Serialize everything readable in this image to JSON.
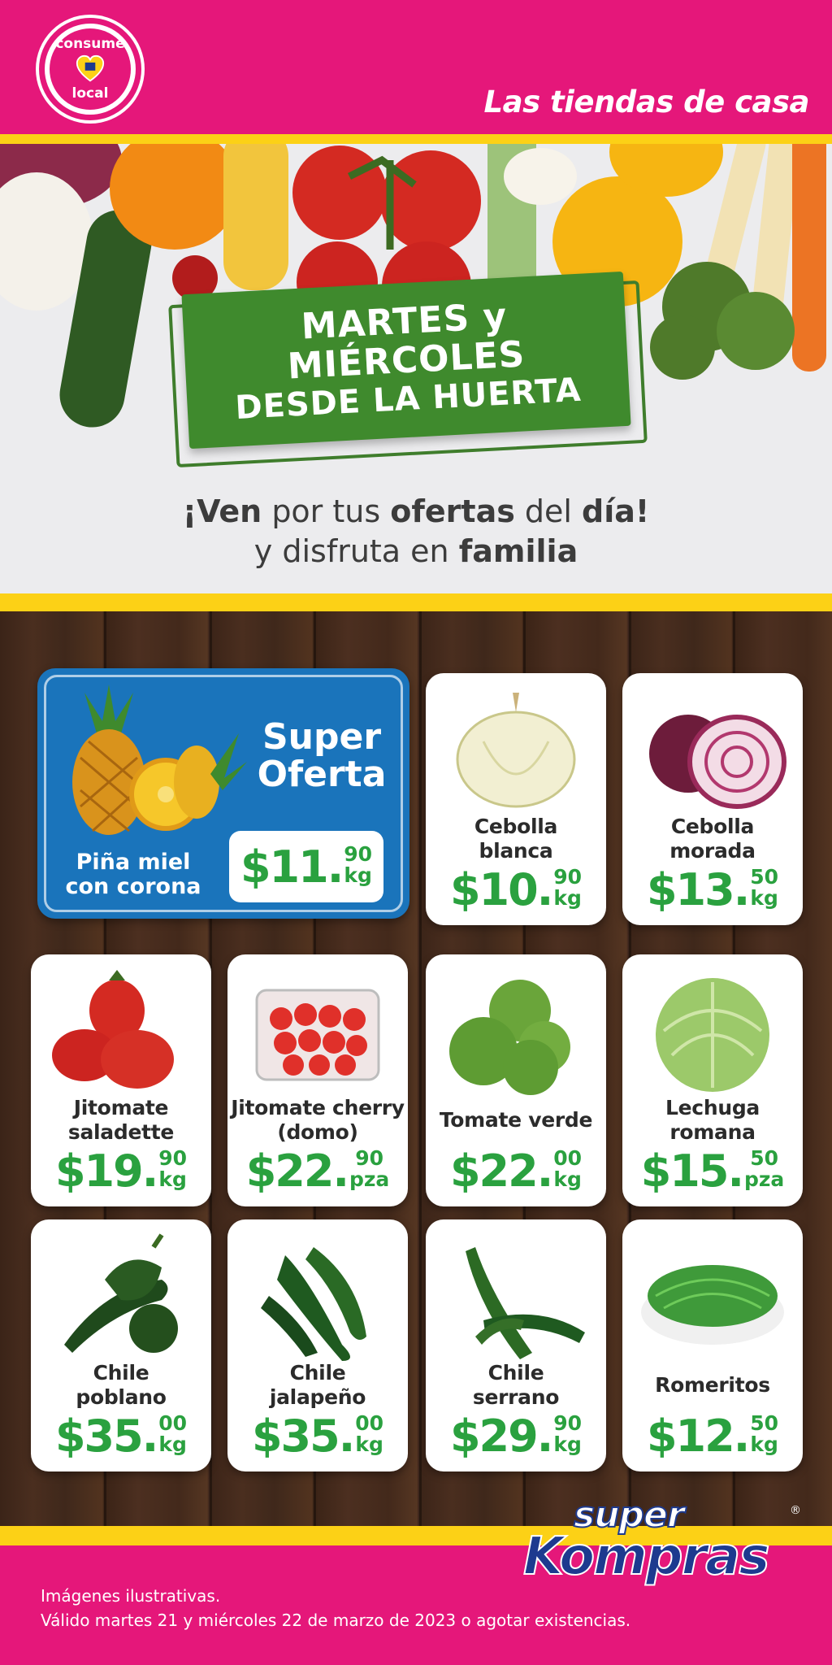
{
  "header": {
    "badge": {
      "top_word": "consume",
      "bottom_word": "local"
    },
    "tagline": "Las tiendas de casa"
  },
  "hero": {
    "sign_line1": "MARTES y MIÉRCOLES",
    "sign_line2": "DESDE LA HUERTA",
    "line1_parts": [
      "¡Ven",
      " por tus ",
      "ofertas",
      " del ",
      "día!"
    ],
    "line2_parts": [
      "y disfruta en ",
      "familia"
    ]
  },
  "super_oferta": {
    "title_line1": "Super",
    "title_line2": "Oferta",
    "name": "Piña miel\ncon corona",
    "price": {
      "main": "$11.",
      "cents": "90",
      "unit": "kg"
    }
  },
  "products": [
    {
      "name": "Cebolla\nblanca",
      "main": "$10.",
      "cents": "90",
      "unit": "kg",
      "icon": "white-onion-icon"
    },
    {
      "name": "Cebolla\nmorada",
      "main": "$13.",
      "cents": "50",
      "unit": "kg",
      "icon": "red-onion-icon"
    },
    {
      "name": "Jitomate\nsaladette",
      "main": "$19.",
      "cents": "90",
      "unit": "kg",
      "icon": "tomato-icon"
    },
    {
      "name": "Jitomate cherry\n(domo)",
      "main": "$22.",
      "cents": "90",
      "unit": "pza",
      "icon": "cherry-tomato-dome-icon"
    },
    {
      "name": "Tomate verde",
      "main": "$22.",
      "cents": "00",
      "unit": "kg",
      "icon": "green-tomato-icon"
    },
    {
      "name": "Lechuga\nromana",
      "main": "$15.",
      "cents": "50",
      "unit": "pza",
      "icon": "lettuce-icon"
    },
    {
      "name": "Chile\npoblano",
      "main": "$35.",
      "cents": "00",
      "unit": "kg",
      "icon": "poblano-pepper-icon"
    },
    {
      "name": "Chile\njalapeño",
      "main": "$35.",
      "cents": "00",
      "unit": "kg",
      "icon": "jalapeno-pepper-icon"
    },
    {
      "name": "Chile\nserrano",
      "main": "$29.",
      "cents": "90",
      "unit": "kg",
      "icon": "serrano-pepper-icon"
    },
    {
      "name": "Romeritos",
      "main": "$12.",
      "cents": "50",
      "unit": "kg",
      "icon": "romeritos-icon"
    }
  ],
  "footer": {
    "note_line1": "Imágenes ilustrativas.",
    "note_line2": "Válido martes 21 y miércoles 22 de marzo de 2023 o agotar existencias.",
    "logo_top": "super",
    "logo_bottom": "Kompras",
    "logo_reg": "®"
  },
  "colors": {
    "magenta": "#e5177a",
    "yellow": "#fcd116",
    "price_green": "#2aa13f",
    "sign_green": "#3f8a2d",
    "offer_blue": "#1a74bb"
  }
}
